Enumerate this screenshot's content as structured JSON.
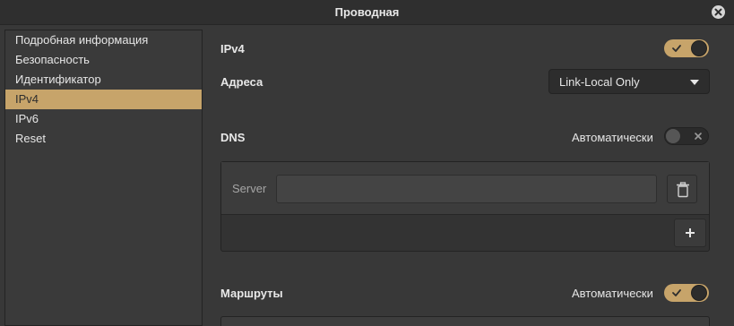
{
  "window": {
    "title": "Проводная"
  },
  "sidebar": {
    "items": [
      {
        "label": "Подробная информация"
      },
      {
        "label": "Безопасность"
      },
      {
        "label": "Идентификатор"
      },
      {
        "label": "IPv4"
      },
      {
        "label": "IPv6"
      },
      {
        "label": "Reset"
      }
    ],
    "selected": "IPv4"
  },
  "ipv4": {
    "heading": "IPv4",
    "enabled": true,
    "addresses_label": "Адреса",
    "method_value": "Link-Local Only"
  },
  "dns": {
    "heading": "DNS",
    "auto_label": "Автоматически",
    "auto_enabled": false,
    "server_label": "Server",
    "server_value": ""
  },
  "routes": {
    "heading": "Маршруты",
    "auto_label": "Автоматически",
    "auto_enabled": true
  },
  "colors": {
    "accent": "#c7a46a",
    "background": "#383838",
    "titlebar": "#2f2f2f"
  },
  "icons": {
    "close": "close-icon",
    "dropdown": "chevron-down-icon",
    "delete": "trash-icon",
    "add": "plus-icon",
    "toggle_on": "check-icon",
    "toggle_off": "x-icon"
  }
}
